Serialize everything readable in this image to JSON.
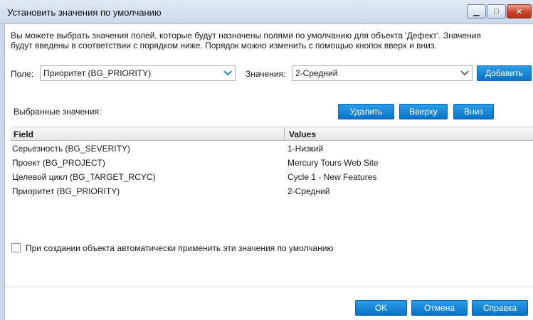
{
  "window": {
    "title": "Установить значения по умолчанию",
    "minimize_glyph": "▁",
    "maximize_glyph": "□",
    "close_glyph": "✕"
  },
  "description": {
    "line1": "Вы можете выбрать значения полей, которые будут назначены полями по умолчанию для объекта 'Дефект'.  Значения",
    "line2": "будут введены в соответствии с порядком ниже. Порядок можно изменить с помощью кнопок вверх и вниз."
  },
  "field": {
    "label": "Поле:",
    "value": "Приоритет (BG_PRIORITY)"
  },
  "values": {
    "label": "Значения:",
    "value": "2-Средний"
  },
  "buttons": {
    "add": "Добавить",
    "remove": "Удалить",
    "up": "Вверху",
    "down": "Вниз",
    "ok": "OK",
    "cancel": "Отмена",
    "help": "Справка"
  },
  "selected_label": "Выбранные значения:",
  "table": {
    "columns": [
      "Field",
      "Values"
    ],
    "rows": [
      {
        "field": "Серьезность (BG_SEVERITY)",
        "value": "1-Низкий"
      },
      {
        "field": "Проект (BG_PROJECT)",
        "value": "Mercury Tours Web Site"
      },
      {
        "field": "Целевой цикл (BG_TARGET_RCYC)",
        "value": "Cycle 1 - New Features"
      },
      {
        "field": "Приоритет (BG_PRIORITY)",
        "value": "2-Средний"
      }
    ]
  },
  "auto_apply": {
    "label": "При создании объекта автоматически применить эти значения по умолчанию",
    "checked": false
  },
  "colors": {
    "accent_button": "#1683d8",
    "combo_arrow": "#2a82c9"
  }
}
